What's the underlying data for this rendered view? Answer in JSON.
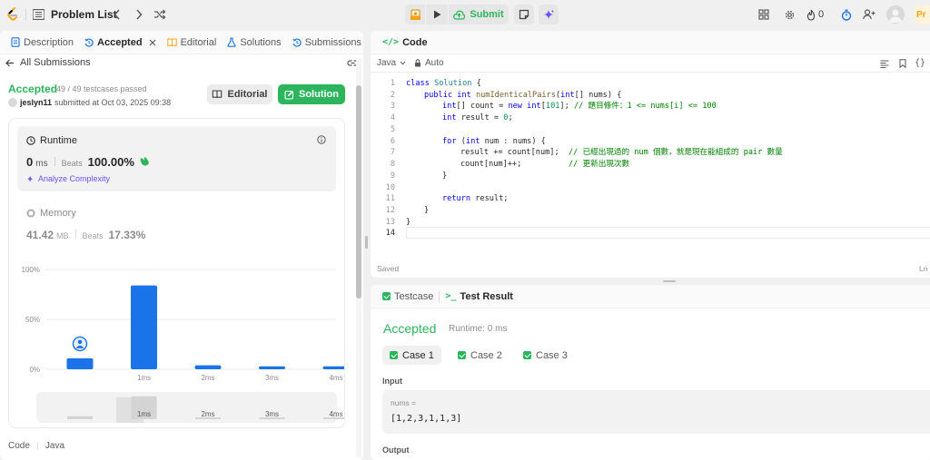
{
  "topbar": {
    "title": "Problem List",
    "submit_label": "Submit",
    "streak_count": "0",
    "premium_label": "Pr"
  },
  "left_panel": {
    "tabs": [
      {
        "label": "Description"
      },
      {
        "label": "Accepted"
      },
      {
        "label": "Editorial"
      },
      {
        "label": "Solutions"
      },
      {
        "label": "Submissions"
      }
    ],
    "back_label": "All Submissions",
    "status": "Accepted",
    "testcases": "49 / 49 testcases passed",
    "username": "jeslyn11",
    "submitted_at": "submitted at Oct 03, 2025 09:38",
    "editorial_button": "Editorial",
    "solution_button": "Solution",
    "runtime": {
      "label": "Runtime",
      "value": "0",
      "unit": "ms",
      "beats_label": "Beats",
      "beats_value": "100.00%",
      "analyze_label": "Analyze Complexity"
    },
    "memory": {
      "label": "Memory",
      "value": "41.42",
      "unit": "MB",
      "beats_label": "Beats",
      "beats_value": "17.33%"
    },
    "footer_code": "Code",
    "footer_lang": "Java"
  },
  "chart_data": {
    "type": "bar",
    "categories": [
      "0ms",
      "1ms",
      "2ms",
      "3ms",
      "4ms"
    ],
    "x_tick_labels": [
      "",
      "1ms",
      "2ms",
      "3ms",
      "4ms"
    ],
    "values": [
      11,
      84,
      4,
      3,
      3
    ],
    "ytick_labels": [
      "100%",
      "50%",
      "0%"
    ],
    "ylim": [
      0,
      100
    ],
    "bar_color": "#1a73e8",
    "highlight_index": 0,
    "minimap_labels": [
      "1ms",
      "2ms",
      "3ms",
      "4ms"
    ]
  },
  "editor": {
    "title": "Code",
    "language": "Java",
    "auto_label": "Auto",
    "saved_label": "Saved",
    "ln_label": "Ln",
    "line_numbers": [
      "1",
      "2",
      "3",
      "4",
      "5",
      "6",
      "7",
      "8",
      "9",
      "10",
      "11",
      "12",
      "13",
      "14"
    ]
  },
  "code_tokens": {
    "l1_a": "class",
    "l1_b": " ",
    "l1_c": "Solution",
    "l1_d": " {",
    "l2_a": "public",
    "l2_b": " ",
    "l2_c": "int",
    "l2_d": " ",
    "l2_e": "numIdenticalPairs",
    "l2_f": "(",
    "l2_g": "int",
    "l2_h": "[] nums) {",
    "l3_a": "int",
    "l3_b": "[] count = ",
    "l3_c": "new",
    "l3_d": " ",
    "l3_e": "int",
    "l3_f": "[",
    "l3_g": "101",
    "l3_h": "]; ",
    "l3_i": "// 題目條件：1 <= nums[i] <= 100",
    "l4_a": "int",
    "l4_b": " result = ",
    "l4_c": "0",
    "l4_d": ";",
    "l6_a": "for",
    "l6_b": " (",
    "l6_c": "int",
    "l6_d": " num : nums) {",
    "l7_a": "result += count[num];  ",
    "l7_b": "// 已經出現過的 num 個數，就是現在能組成的 pair 數量",
    "l8_a": "count[num]++;          ",
    "l8_b": "// 更新出現次數",
    "l9_a": "}",
    "l11_a": "return",
    "l11_b": " result;",
    "l12_a": "}",
    "l13_a": "}"
  },
  "result_panel": {
    "tabs": [
      {
        "label": "Testcase"
      },
      {
        "label": "Test Result"
      }
    ],
    "status": "Accepted",
    "runtime": "Runtime: 0 ms",
    "cases": [
      {
        "label": "Case 1"
      },
      {
        "label": "Case 2"
      },
      {
        "label": "Case 3"
      }
    ],
    "input_label": "Input",
    "var_name": "nums =",
    "var_value": "[1,2,3,1,1,3]",
    "output_label": "Output"
  }
}
